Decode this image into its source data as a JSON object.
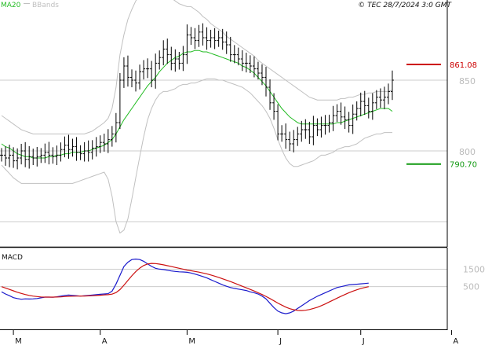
{
  "header": {
    "legend_ma": "MA20",
    "legend_bb": "BBands",
    "copyright": "© TEC 28/7/2024 3:0 GMT"
  },
  "colors": {
    "ma": "#22bb22",
    "bands": "#c0c0c0",
    "price": "#000000",
    "resistance": "#cc0000",
    "support": "#119911",
    "macd": "#1a1acc",
    "signal": "#cc1111",
    "grid": "#cccccc",
    "axis_text": "#bbbbbb"
  },
  "chart_data": [
    {
      "type": "ohlc",
      "name": "price",
      "y_ticks": [
        "850",
        "800"
      ],
      "ylim": [
        740,
        900
      ],
      "levels": [
        {
          "label": "861.08",
          "value": 861.08,
          "kind": "resistance"
        },
        {
          "label": "790.70",
          "value": 790.7,
          "kind": "support"
        }
      ],
      "close": [
        797,
        795,
        797,
        793,
        795,
        800,
        794,
        796,
        795,
        796,
        797,
        799,
        797,
        796,
        797,
        801,
        804,
        801,
        803,
        799,
        798,
        800,
        799,
        802,
        803,
        806,
        805,
        808,
        812,
        820,
        850,
        860,
        852,
        850,
        848,
        856,
        858,
        858,
        850,
        862,
        866,
        872,
        868,
        862,
        865,
        862,
        868,
        882,
        880,
        878,
        884,
        880,
        878,
        880,
        878,
        880,
        877,
        875,
        868,
        868,
        865,
        862,
        862,
        860,
        858,
        855,
        852,
        845,
        834,
        828,
        812,
        812,
        808,
        805,
        808,
        812,
        815,
        815,
        810,
        818,
        815,
        818,
        818,
        820,
        825,
        828,
        824,
        822,
        818,
        826,
        830,
        835,
        832,
        828,
        834,
        838,
        836,
        838,
        842,
        850
      ],
      "ma20": [
        805,
        803,
        802,
        800,
        798,
        797,
        796,
        796,
        795,
        795,
        795,
        795,
        796,
        796,
        797,
        797,
        798,
        798,
        799,
        799,
        799,
        800,
        800,
        801,
        802,
        803,
        804,
        806,
        808,
        812,
        817,
        822,
        826,
        830,
        834,
        838,
        842,
        846,
        849,
        852,
        856,
        859,
        862,
        864,
        866,
        867,
        869,
        870,
        870,
        871,
        871,
        870,
        870,
        869,
        868,
        867,
        866,
        865,
        864,
        863,
        862,
        860,
        859,
        857,
        855,
        852,
        849,
        846,
        842,
        838,
        834,
        830,
        827,
        824,
        822,
        820,
        819,
        819,
        819,
        819,
        819,
        819,
        819,
        819,
        819,
        820,
        820,
        821,
        822,
        823,
        824,
        825,
        826,
        827,
        828,
        829,
        830,
        830,
        830,
        828
      ],
      "upper_band": [
        825,
        823,
        821,
        819,
        817,
        815,
        814,
        813,
        812,
        812,
        812,
        812,
        812,
        812,
        812,
        812,
        812,
        812,
        812,
        812,
        812,
        812,
        813,
        814,
        816,
        818,
        820,
        823,
        830,
        845,
        868,
        882,
        893,
        900,
        906,
        910,
        913,
        914,
        914,
        914,
        913,
        912,
        910,
        908,
        906,
        904,
        903,
        902,
        902,
        900,
        898,
        895,
        893,
        890,
        888,
        886,
        884,
        881,
        879,
        877,
        875,
        873,
        871,
        869,
        867,
        864,
        862,
        860,
        858,
        856,
        854,
        852,
        850,
        848,
        846,
        844,
        842,
        840,
        838,
        837,
        836,
        836,
        836,
        836,
        836,
        836,
        837,
        837,
        838,
        838,
        839,
        840,
        840,
        841,
        841,
        842,
        842,
        842,
        842,
        843
      ],
      "lower_band": [
        790,
        787,
        784,
        781,
        779,
        777,
        777,
        777,
        777,
        777,
        777,
        777,
        777,
        777,
        777,
        777,
        777,
        777,
        777,
        778,
        779,
        780,
        781,
        782,
        783,
        784,
        785,
        780,
        768,
        750,
        742,
        744,
        752,
        766,
        781,
        796,
        810,
        822,
        830,
        836,
        840,
        842,
        842,
        843,
        844,
        846,
        847,
        847,
        848,
        848,
        849,
        850,
        851,
        851,
        851,
        850,
        850,
        849,
        848,
        847,
        846,
        845,
        843,
        841,
        838,
        835,
        832,
        828,
        823,
        816,
        808,
        801,
        795,
        791,
        789,
        789,
        790,
        791,
        792,
        793,
        795,
        797,
        797,
        798,
        799,
        801,
        802,
        803,
        803,
        804,
        805,
        807,
        809,
        810,
        811,
        812,
        812,
        813,
        813,
        813
      ]
    },
    {
      "type": "line",
      "name": "MACD",
      "title": "MACD",
      "y_ticks": [
        "1500",
        "500"
      ],
      "ylim": [
        -1900,
        2600
      ],
      "series": [
        {
          "name": "macd",
          "values": [
            200,
            80,
            -20,
            -130,
            -180,
            -220,
            -200,
            -210,
            -200,
            -180,
            -140,
            -100,
            -100,
            -110,
            -80,
            -40,
            0,
            20,
            0,
            -20,
            -40,
            -20,
            0,
            20,
            40,
            60,
            80,
            100,
            240,
            650,
            1150,
            1650,
            1900,
            2050,
            2080,
            2050,
            1950,
            1800,
            1660,
            1550,
            1500,
            1480,
            1440,
            1400,
            1370,
            1350,
            1340,
            1320,
            1280,
            1220,
            1150,
            1080,
            1000,
            900,
            800,
            700,
            600,
            520,
            450,
            400,
            360,
            320,
            280,
            200,
            150,
            80,
            -40,
            -200,
            -450,
            -700,
            -900,
            -1000,
            -1050,
            -1000,
            -900,
            -750,
            -600,
            -450,
            -300,
            -170,
            -50,
            50,
            150,
            250,
            350,
            450,
            500,
            550,
            600,
            620,
            640,
            660,
            680,
            700
          ]
        },
        {
          "name": "signal",
          "values": [
            500,
            420,
            340,
            260,
            180,
            110,
            50,
            0,
            -40,
            -70,
            -90,
            -100,
            -100,
            -100,
            -95,
            -85,
            -70,
            -55,
            -45,
            -40,
            -38,
            -35,
            -30,
            -20,
            -5,
            10,
            25,
            40,
            70,
            160,
            330,
            580,
            860,
            1120,
            1360,
            1560,
            1710,
            1800,
            1830,
            1820,
            1790,
            1750,
            1700,
            1650,
            1600,
            1550,
            1500,
            1450,
            1410,
            1370,
            1330,
            1280,
            1230,
            1170,
            1100,
            1030,
            950,
            870,
            790,
            700,
            610,
            520,
            430,
            340,
            250,
            150,
            50,
            -60,
            -180,
            -310,
            -440,
            -560,
            -670,
            -760,
            -820,
            -860,
            -870,
            -850,
            -810,
            -750,
            -680,
            -590,
            -490,
            -380,
            -270,
            -160,
            -50,
            50,
            150,
            240,
            320,
            390,
            450,
            500
          ]
        }
      ]
    }
  ],
  "x_axis": {
    "labels": [
      {
        "text": "M",
        "index": 3
      },
      {
        "text": "A",
        "index": 25
      },
      {
        "text": "M",
        "index": 47
      },
      {
        "text": "J",
        "index": 70
      },
      {
        "text": "J",
        "index": 91
      },
      {
        "text": "A",
        "index": 114
      }
    ],
    "total_slots": 120
  }
}
